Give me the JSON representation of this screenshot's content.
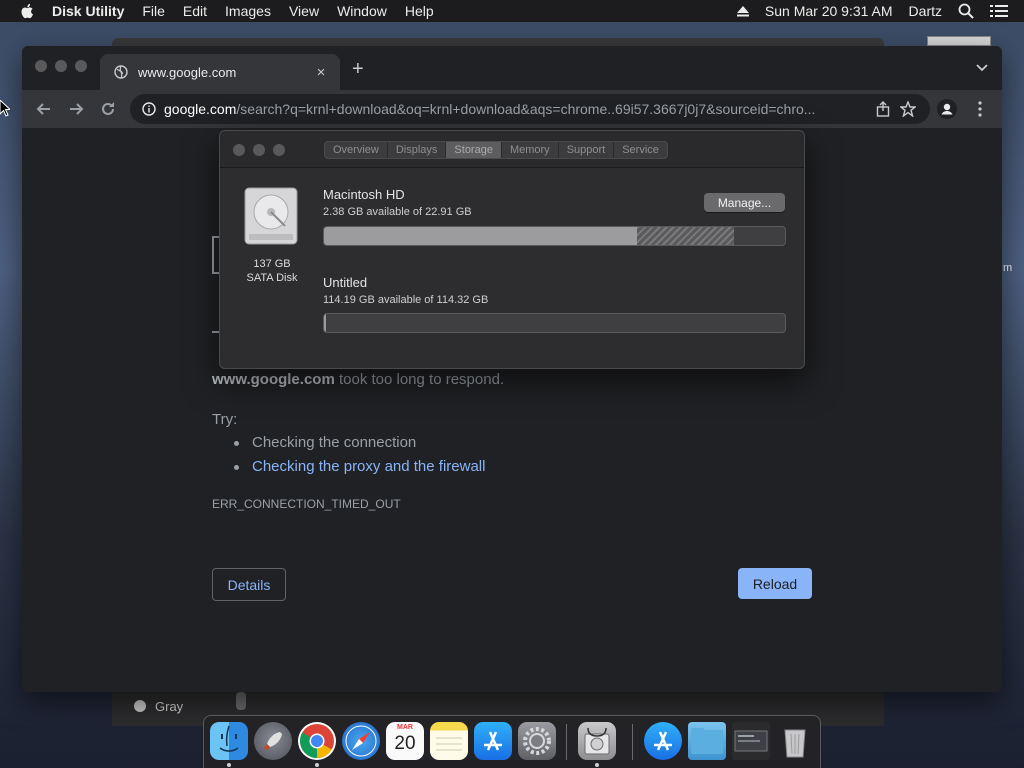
{
  "menubar": {
    "app_name": "Disk Utility",
    "items": [
      "File",
      "Edit",
      "Images",
      "View",
      "Window",
      "Help"
    ],
    "clock": "Sun Mar 20  9:31 AM",
    "user": "Dartz"
  },
  "chrome": {
    "tab_title": "www.google.com",
    "new_tab": "+",
    "close_tab": "×",
    "url_host": "google.com",
    "url_rest": "/search?q=krnl+download&oq=krnl+download&aqs=chrome..69i57.3667j0j7&sourceid=chro..."
  },
  "error_page": {
    "host_bold": "www.google.com",
    "message": " took too long to respond.",
    "try_label": "Try:",
    "suggestions": [
      "Checking the connection",
      "Checking the proxy and the firewall"
    ],
    "error_code": "ERR_CONNECTION_TIMED_OUT",
    "details_button": "Details",
    "reload_button": "Reload"
  },
  "storage_window": {
    "tabs": [
      "Overview",
      "Displays",
      "Storage",
      "Memory",
      "Support",
      "Service"
    ],
    "active_tab": "Storage",
    "disk": {
      "size": "137 GB",
      "type": "SATA Disk"
    },
    "volumes": [
      {
        "name": "Macintosh HD",
        "available": "2.38 GB available of 22.91 GB",
        "used_fraction": 0.68,
        "purgeable_fraction": 0.21
      },
      {
        "name": "Untitled",
        "available": "114.19 GB available of 114.32 GB",
        "used_fraction": 0.004,
        "purgeable_fraction": 0
      }
    ],
    "manage_button": "Manage..."
  },
  "background": {
    "radio_label": "Gray",
    "edge_text": "m"
  },
  "dock": {
    "calendar_month": "MAR",
    "calendar_day": "20",
    "apps": [
      "finder-icon",
      "launchpad-icon",
      "chrome-icon",
      "safari-icon",
      "calendar-icon",
      "notes-icon",
      "app-store-icon",
      "system-preferences-icon",
      "disk-utility-icon",
      "app-store-icon",
      "folder-icon",
      "screenshot-icon",
      "trash-icon"
    ]
  },
  "colors": {
    "link": "#8ab4f8",
    "reload_bg": "#8ab4f8"
  }
}
